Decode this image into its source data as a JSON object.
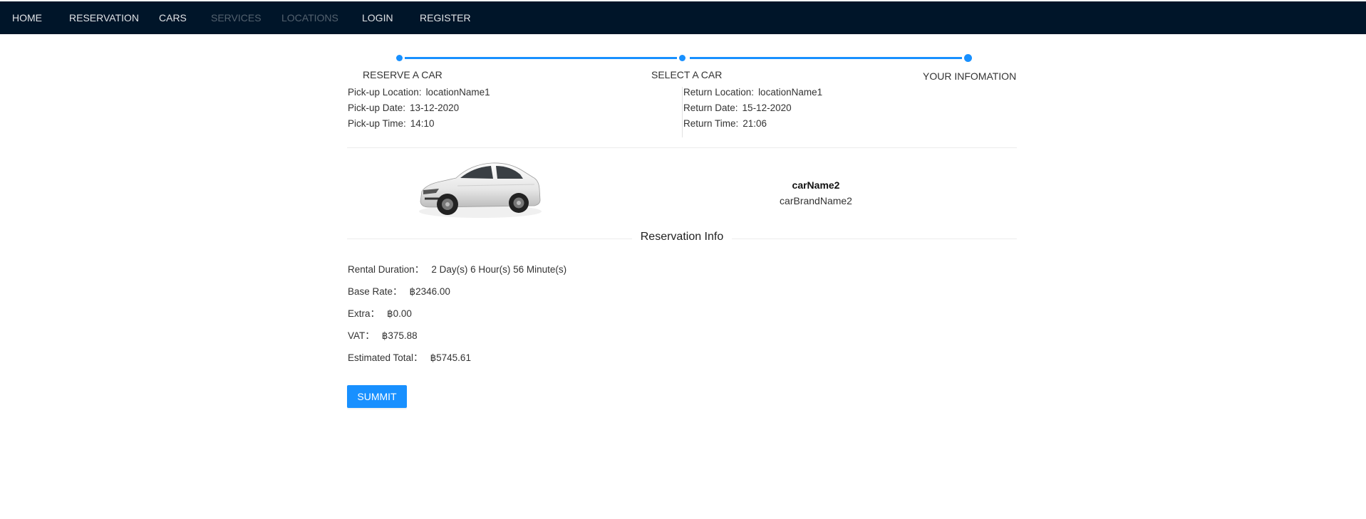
{
  "nav": {
    "items": [
      {
        "label": "HOME"
      },
      {
        "label": "RESERVATION"
      },
      {
        "label": "CARS"
      },
      {
        "label": "SERVICES"
      },
      {
        "label": "LOCATIONS"
      },
      {
        "label": "LOGIN"
      },
      {
        "label": "REGISTER"
      }
    ]
  },
  "steps": {
    "items": [
      {
        "label": "RESERVE A CAR"
      },
      {
        "label": "SELECT A CAR"
      },
      {
        "label": "YOUR INFOMATION"
      }
    ]
  },
  "pickup": {
    "location_label": "Pick-up Location:",
    "location": "locationName1",
    "date_label": "Pick-up Date:",
    "date": "13-12-2020",
    "time_label": "Pick-up Time:",
    "time": "14:10"
  },
  "return": {
    "location_label": "Return Location:",
    "location": "locationName1",
    "date_label": "Return Date:",
    "date": "15-12-2020",
    "time_label": "Return Time:",
    "time": "21:06"
  },
  "car": {
    "name": "carName2",
    "brand": "carBrandName2",
    "image_icon": "car-photo"
  },
  "reservation": {
    "title": "Reservation Info",
    "rows": [
      {
        "label": "Rental Duration：",
        "value": "2 Day(s) 6 Hour(s) 56 Minute(s)"
      },
      {
        "label": "Base Rate：",
        "value": "฿2346.00"
      },
      {
        "label": "Extra：",
        "value": "฿0.00"
      },
      {
        "label": "VAT：",
        "value": "฿375.88"
      },
      {
        "label": "Estimated Total：",
        "value": "฿5745.61"
      }
    ]
  },
  "submit_label": "SUMMIT",
  "colors": {
    "topbar": "#001529",
    "accent": "#1890ff"
  }
}
